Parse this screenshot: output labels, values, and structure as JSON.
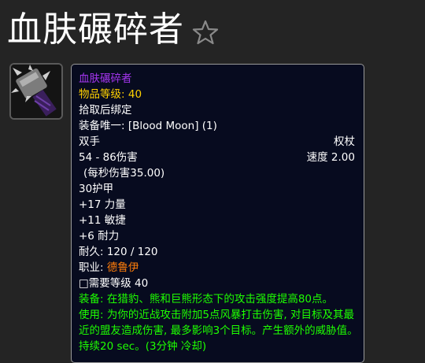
{
  "page": {
    "title": "血肤碾碎者"
  },
  "item": {
    "name": "血肤碾碎者",
    "item_level_label": "物品等级:",
    "item_level_value": "40",
    "bind": "拾取后绑定",
    "unique_equip": "装备唯一: [Blood Moon] (1)",
    "slot": "双手",
    "type": "权杖",
    "damage": "54 - 86伤害",
    "speed": "速度 2.00",
    "dps": "(每秒伤害35.00)",
    "armor": "30护甲",
    "stats": [
      "+17 力量",
      "+11 敏捷",
      "+6 耐力"
    ],
    "durability": "耐久: 120 / 120",
    "class_label": "职业:",
    "class_value": "德鲁伊",
    "required_level": "□需要等级 40",
    "effects": [
      "装备: 在猎豹、熊和巨熊形态下的攻击强度提高80点。",
      "使用: 为你的近战攻击附加5点风暴打击伤害, 对目标及其最近的盟友造成伤害, 最多影响3个目标。产生额外的威胁值。持续20 sec。(3分钟 冷却)"
    ]
  },
  "colors": {
    "epic": "#a335ee",
    "item_level": "#ffd100",
    "class_druid": "#ff7d0a",
    "effect_green": "#1eff00",
    "tooltip_bg": "#070b1f"
  },
  "icons": {
    "favorite": "star-outline-icon",
    "item": "spiked-mace-icon"
  }
}
